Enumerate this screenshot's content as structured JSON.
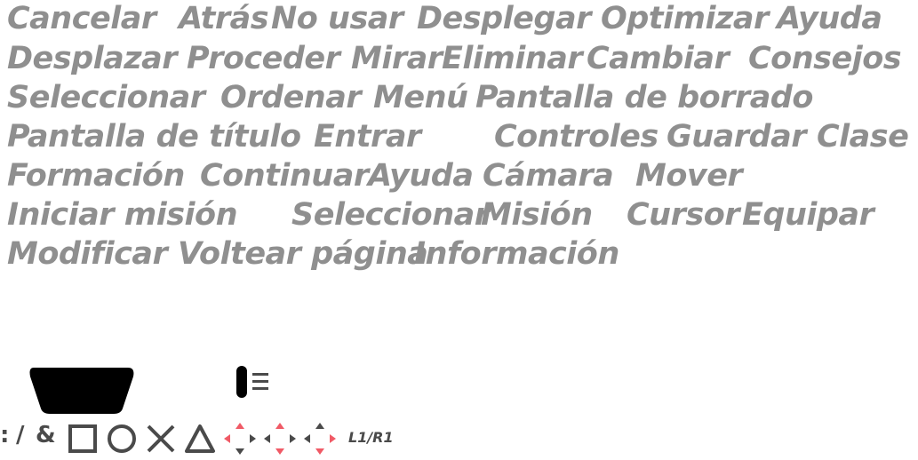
{
  "words": [
    "Cancelar",
    "Atrás",
    "No usar",
    "Desplegar",
    "Optimizar",
    "Ayuda",
    "Desplazar",
    "Proceder",
    "Mirar",
    "Eliminar",
    "Cambiar",
    "Consejos",
    "Seleccionar",
    "Ordenar",
    "Menú",
    "Pantalla de borrado",
    "Pantalla de título",
    "Entrar",
    "Controles",
    "Guardar",
    "Clase",
    "Formación",
    "Continuar",
    "Ayuda",
    "Cámara",
    "Mover",
    "Iniciar misión",
    "Seleccionar",
    "Misión",
    "Cursor",
    "Equipar",
    "Modificar",
    "Voltear página",
    "Información"
  ],
  "glyphs": {
    "colon": ":",
    "slash": "/",
    "ampersand": "&",
    "shoulder": "L1/R1"
  },
  "colors": {
    "text": "#8f8f8f",
    "glyph": "#4a4a4a",
    "dpad_active": "#f05a66",
    "dpad_inactive": "#4a4a4a"
  },
  "icons": [
    "button-bar-icon",
    "menu-toggle-icon",
    "square-icon",
    "circle-icon",
    "cross-icon",
    "triangle-icon",
    "dpad-left-right-icon",
    "dpad-up-down-icon",
    "dpad-down-icon"
  ]
}
